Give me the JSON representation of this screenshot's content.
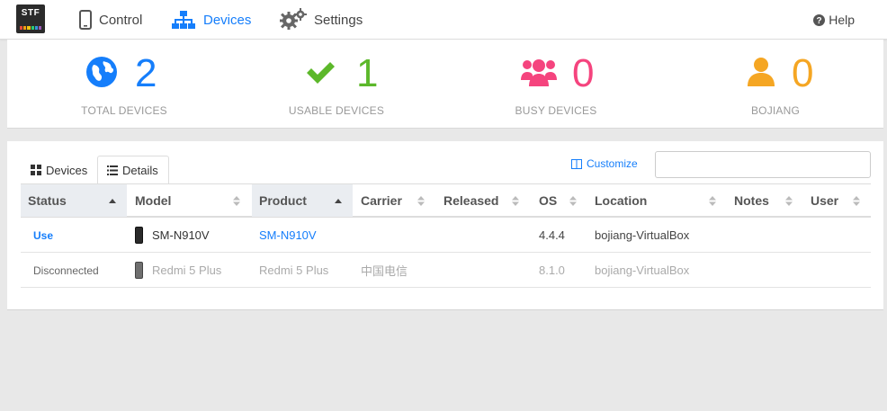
{
  "nav": {
    "logo_text": "STF",
    "control_label": "Control",
    "devices_label": "Devices",
    "settings_label": "Settings",
    "help_label": "Help"
  },
  "stats": [
    {
      "value": "2",
      "label": "TOTAL DEVICES",
      "icon": "globe-icon",
      "color": "#157efb"
    },
    {
      "value": "1",
      "label": "USABLE DEVICES",
      "icon": "check-icon",
      "color": "#5cb82a"
    },
    {
      "value": "0",
      "label": "BUSY DEVICES",
      "icon": "users-icon",
      "color": "#f5447e"
    },
    {
      "value": "0",
      "label": "BOJIANG",
      "icon": "user-icon",
      "color": "#f5a623"
    }
  ],
  "tabs": {
    "devices_label": "Devices",
    "details_label": "Details",
    "active": "Details"
  },
  "customize_label": "Customize",
  "search": {
    "value": "",
    "placeholder": ""
  },
  "table": {
    "columns": [
      "Status",
      "Model",
      "Product",
      "Carrier",
      "Released",
      "OS",
      "Location",
      "Notes",
      "User"
    ],
    "sorted_columns": [
      "Status",
      "Product"
    ],
    "rows": [
      {
        "status": "Use",
        "model": "SM-N910V",
        "product": "SM-N910V",
        "carrier": "",
        "released": "",
        "os": "4.4.4",
        "location": "bojiang-VirtualBox",
        "notes": "",
        "user": ""
      },
      {
        "status": "Disconnected",
        "model": "Redmi 5 Plus",
        "product": "Redmi 5 Plus",
        "carrier": "中国电信",
        "released": "",
        "os": "8.1.0",
        "location": "bojiang-VirtualBox",
        "notes": "",
        "user": ""
      }
    ]
  }
}
